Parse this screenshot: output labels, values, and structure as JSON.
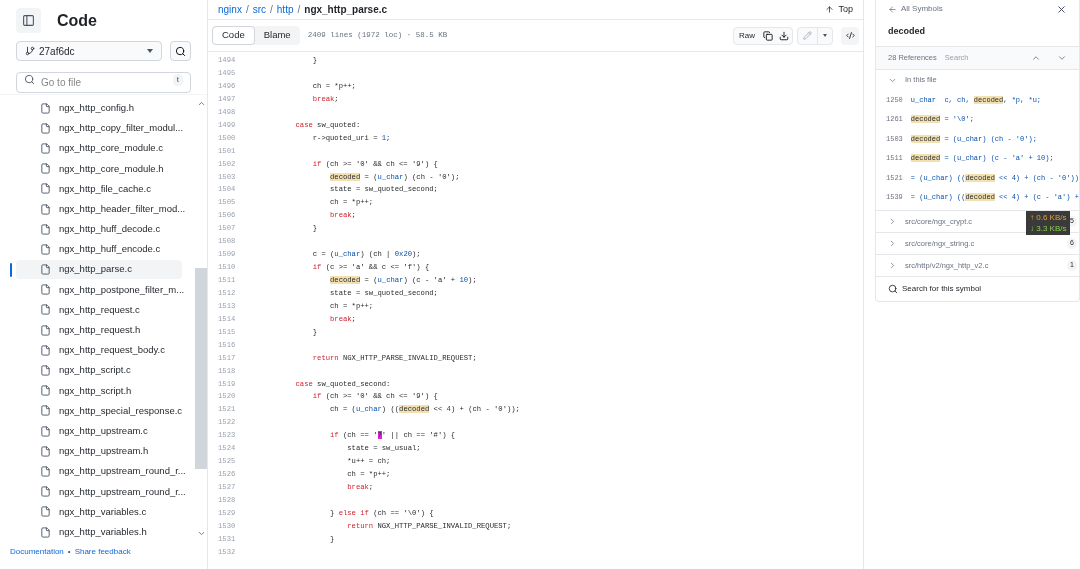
{
  "sidebar": {
    "title": "Code",
    "branch": "27af6dc",
    "search": {
      "placeholder": "Go to file",
      "shortcut": "t"
    },
    "files": [
      {
        "name": "ngx_http_config.h",
        "selected": false
      },
      {
        "name": "ngx_http_copy_filter_modul...",
        "selected": false
      },
      {
        "name": "ngx_http_core_module.c",
        "selected": false
      },
      {
        "name": "ngx_http_core_module.h",
        "selected": false
      },
      {
        "name": "ngx_http_file_cache.c",
        "selected": false
      },
      {
        "name": "ngx_http_header_filter_mod...",
        "selected": false
      },
      {
        "name": "ngx_http_huff_decode.c",
        "selected": false
      },
      {
        "name": "ngx_http_huff_encode.c",
        "selected": false
      },
      {
        "name": "ngx_http_parse.c",
        "selected": true
      },
      {
        "name": "ngx_http_postpone_filter_m...",
        "selected": false
      },
      {
        "name": "ngx_http_request.c",
        "selected": false
      },
      {
        "name": "ngx_http_request.h",
        "selected": false
      },
      {
        "name": "ngx_http_request_body.c",
        "selected": false
      },
      {
        "name": "ngx_http_script.c",
        "selected": false
      },
      {
        "name": "ngx_http_script.h",
        "selected": false
      },
      {
        "name": "ngx_http_special_response.c",
        "selected": false
      },
      {
        "name": "ngx_http_upstream.c",
        "selected": false
      },
      {
        "name": "ngx_http_upstream.h",
        "selected": false
      },
      {
        "name": "ngx_http_upstream_round_r...",
        "selected": false
      },
      {
        "name": "ngx_http_upstream_round_r...",
        "selected": false
      },
      {
        "name": "ngx_http_variables.c",
        "selected": false
      },
      {
        "name": "ngx_http_variables.h",
        "selected": false
      }
    ],
    "footer_links": [
      "Documentation",
      "Share feedback"
    ],
    "footer_separator": "•"
  },
  "breadcrumb": {
    "links": [
      "nginx",
      "src",
      "http"
    ],
    "separator": "/",
    "current": "ngx_http_parse.c",
    "top": "Top"
  },
  "toolbar": {
    "tabs": [
      {
        "label": "Code",
        "selected": true
      },
      {
        "label": "Blame",
        "selected": false
      }
    ],
    "info": "2409 lines (1972 loc) · 58.5 KB",
    "raw": "Raw"
  },
  "code_lines": [
    {
      "num": "1494",
      "tokens": [
        {
          "kind": "plain",
          "text": "            }"
        }
      ]
    },
    {
      "num": "1495"
    },
    {
      "num": "1496",
      "tokens": [
        {
          "kind": "plain",
          "text": "            ch = *p++;"
        }
      ]
    },
    {
      "num": "1497",
      "tokens": [
        {
          "kind": "keyword",
          "text": "            break"
        },
        {
          "kind": "plain",
          "text": ";"
        }
      ]
    },
    {
      "num": "1498"
    },
    {
      "num": "1499",
      "tokens": [
        {
          "kind": "keyword",
          "text": "        case"
        },
        {
          "kind": "plain",
          "text": " sw_quoted:"
        }
      ]
    },
    {
      "num": "1500",
      "tokens": [
        {
          "kind": "plain",
          "text": "            r->quoted_uri = "
        },
        {
          "kind": "number",
          "text": "1"
        },
        {
          "kind": "plain",
          "text": ";"
        }
      ]
    },
    {
      "num": "1501"
    },
    {
      "num": "1502",
      "tokens": [
        {
          "kind": "keyword",
          "text": "            if"
        },
        {
          "kind": "plain",
          "text": " (ch >= '0' && ch <= '9') {"
        }
      ]
    },
    {
      "num": "1503",
      "tokens": [
        {
          "kind": "match",
          "text": "                decoded"
        },
        {
          "kind": "plain",
          "text": " = ("
        },
        {
          "kind": "type",
          "text": "u_char"
        },
        {
          "kind": "plain",
          "text": ") (ch - '0');"
        }
      ]
    },
    {
      "num": "1504",
      "tokens": [
        {
          "kind": "plain",
          "text": "                state = sw_quoted_second;"
        }
      ]
    },
    {
      "num": "1505",
      "tokens": [
        {
          "kind": "plain",
          "text": "                ch = *p++;"
        }
      ]
    },
    {
      "num": "1506",
      "tokens": [
        {
          "kind": "keyword",
          "text": "                break"
        },
        {
          "kind": "plain",
          "text": ";"
        }
      ]
    },
    {
      "num": "1507",
      "tokens": [
        {
          "kind": "plain",
          "text": "            }"
        }
      ]
    },
    {
      "num": "1508"
    },
    {
      "num": "1509",
      "tokens": [
        {
          "kind": "plain",
          "text": "            c = ("
        },
        {
          "kind": "type",
          "text": "u_char"
        },
        {
          "kind": "plain",
          "text": ") (ch | "
        },
        {
          "kind": "number",
          "text": "0x20"
        },
        {
          "kind": "plain",
          "text": ");"
        }
      ]
    },
    {
      "num": "1510",
      "tokens": [
        {
          "kind": "keyword",
          "text": "            if"
        },
        {
          "kind": "plain",
          "text": " (c >= 'a' && c <= 'f') {"
        }
      ]
    },
    {
      "num": "1511",
      "tokens": [
        {
          "kind": "match",
          "text": "                decoded"
        },
        {
          "kind": "plain",
          "text": " = ("
        },
        {
          "kind": "type",
          "text": "u_char"
        },
        {
          "kind": "plain",
          "text": ") (c - 'a' + "
        },
        {
          "kind": "number",
          "text": "10"
        },
        {
          "kind": "plain",
          "text": ");"
        }
      ]
    },
    {
      "num": "1512",
      "tokens": [
        {
          "kind": "plain",
          "text": "                state = sw_quoted_second;"
        }
      ]
    },
    {
      "num": "1513",
      "tokens": [
        {
          "kind": "plain",
          "text": "                ch = *p++;"
        }
      ]
    },
    {
      "num": "1514",
      "tokens": [
        {
          "kind": "keyword",
          "text": "                break"
        },
        {
          "kind": "plain",
          "text": ";"
        }
      ]
    },
    {
      "num": "1515",
      "tokens": [
        {
          "kind": "plain",
          "text": "            }"
        }
      ]
    },
    {
      "num": "1516"
    },
    {
      "num": "1517",
      "tokens": [
        {
          "kind": "keyword",
          "text": "            return"
        },
        {
          "kind": "plain",
          "text": " NGX_HTTP_PARSE_INVALID_REQUEST;"
        }
      ]
    },
    {
      "num": "1518"
    },
    {
      "num": "1519",
      "tokens": [
        {
          "kind": "keyword",
          "text": "        case"
        },
        {
          "kind": "plain",
          "text": " sw_quoted_second:"
        }
      ]
    },
    {
      "num": "1520",
      "tokens": [
        {
          "kind": "keyword",
          "text": "            if"
        },
        {
          "kind": "plain",
          "text": " (ch >= '0' && ch <= '9') {"
        }
      ]
    },
    {
      "num": "1521",
      "tokens": [
        {
          "kind": "plain",
          "text": "                ch = ("
        },
        {
          "kind": "type",
          "text": "u_char"
        },
        {
          "kind": "plain",
          "text": ") (("
        },
        {
          "kind": "match",
          "text": "decoded"
        },
        {
          "kind": "plain",
          "text": " << "
        },
        {
          "kind": "number",
          "text": "4"
        },
        {
          "kind": "plain",
          "text": ") + (ch - '0'));"
        }
      ]
    },
    {
      "num": "1522"
    },
    {
      "num": "1523",
      "tokens": [
        {
          "kind": "keyword",
          "text": "                if"
        },
        {
          "kind": "plain",
          "text": " (ch == '"
        },
        {
          "kind": "cursor",
          "text": "?"
        },
        {
          "kind": "plain",
          "text": "' || ch == '#') {"
        }
      ]
    },
    {
      "num": "1524",
      "tokens": [
        {
          "kind": "plain",
          "text": "                    state = sw_usual;"
        }
      ]
    },
    {
      "num": "1525",
      "tokens": [
        {
          "kind": "plain",
          "text": "                    *u++ = ch;"
        }
      ]
    },
    {
      "num": "1526",
      "tokens": [
        {
          "kind": "plain",
          "text": "                    ch = *p++;"
        }
      ]
    },
    {
      "num": "1527",
      "tokens": [
        {
          "kind": "keyword",
          "text": "                    break"
        },
        {
          "kind": "plain",
          "text": ";"
        }
      ]
    },
    {
      "num": "1528"
    },
    {
      "num": "1529",
      "tokens": [
        {
          "kind": "plain",
          "text": "                } "
        },
        {
          "kind": "keyword",
          "text": "else if"
        },
        {
          "kind": "plain",
          "text": " (ch == '\\0') {"
        }
      ]
    },
    {
      "num": "1530",
      "tokens": [
        {
          "kind": "keyword",
          "text": "                    return"
        },
        {
          "kind": "plain",
          "text": " NGX_HTTP_PARSE_INVALID_REQUEST;"
        }
      ]
    },
    {
      "num": "1531",
      "tokens": [
        {
          "kind": "plain",
          "text": "                }"
        }
      ]
    },
    {
      "num": "1532"
    }
  ],
  "symbols": {
    "back": "All Symbols",
    "name": "decoded",
    "references": "28 References",
    "search": "Search",
    "this_file": {
      "label": "In this file",
      "expanded": true,
      "refs": [
        {
          "num": "1250",
          "tokens": [
            {
              "kind": "plain",
              "text": "u_char  c, ch, "
            },
            {
              "kind": "match",
              "text": "decoded"
            },
            {
              "kind": "plain",
              "text": ", *p, *u;"
            }
          ]
        },
        {
          "num": "1261",
          "tokens": [
            {
              "kind": "match",
              "text": "decoded"
            },
            {
              "kind": "plain",
              "text": " = '\\0';"
            }
          ]
        },
        {
          "num": "1503",
          "tokens": [
            {
              "kind": "match",
              "text": "decoded"
            },
            {
              "kind": "plain",
              "text": " = (u_char) (ch - '0');"
            }
          ]
        },
        {
          "num": "1511",
          "tokens": [
            {
              "kind": "match",
              "text": "decoded"
            },
            {
              "kind": "plain",
              "text": " = (u_char) (c - 'a' + 10);"
            }
          ]
        },
        {
          "num": "1521",
          "tokens": [
            {
              "kind": "plain",
              "text": "= (u_char) (("
            },
            {
              "kind": "match",
              "text": "decoded"
            },
            {
              "kind": "plain",
              "text": " << 4) + (ch - '0'))"
            }
          ]
        },
        {
          "num": "1539",
          "tokens": [
            {
              "kind": "plain",
              "text": "= (u_char) (("
            },
            {
              "kind": "match",
              "text": "decoded"
            },
            {
              "kind": "plain",
              "text": " << 4) + (c - 'a') +"
            }
          ]
        }
      ]
    },
    "other_files": [
      {
        "path": "src/core/ngx_crypt.c",
        "count": "5",
        "expanded": false
      },
      {
        "path": "src/core/ngx_string.c",
        "count": "6",
        "expanded": false
      },
      {
        "path": "src/http/v2/ngx_http_v2.c",
        "count": "1",
        "expanded": false
      }
    ],
    "search_symbol": "Search for this symbol"
  },
  "net_overlay": {
    "up": "↑ 0.6 KB/s",
    "down": "↓ 3.3 KB/s"
  }
}
